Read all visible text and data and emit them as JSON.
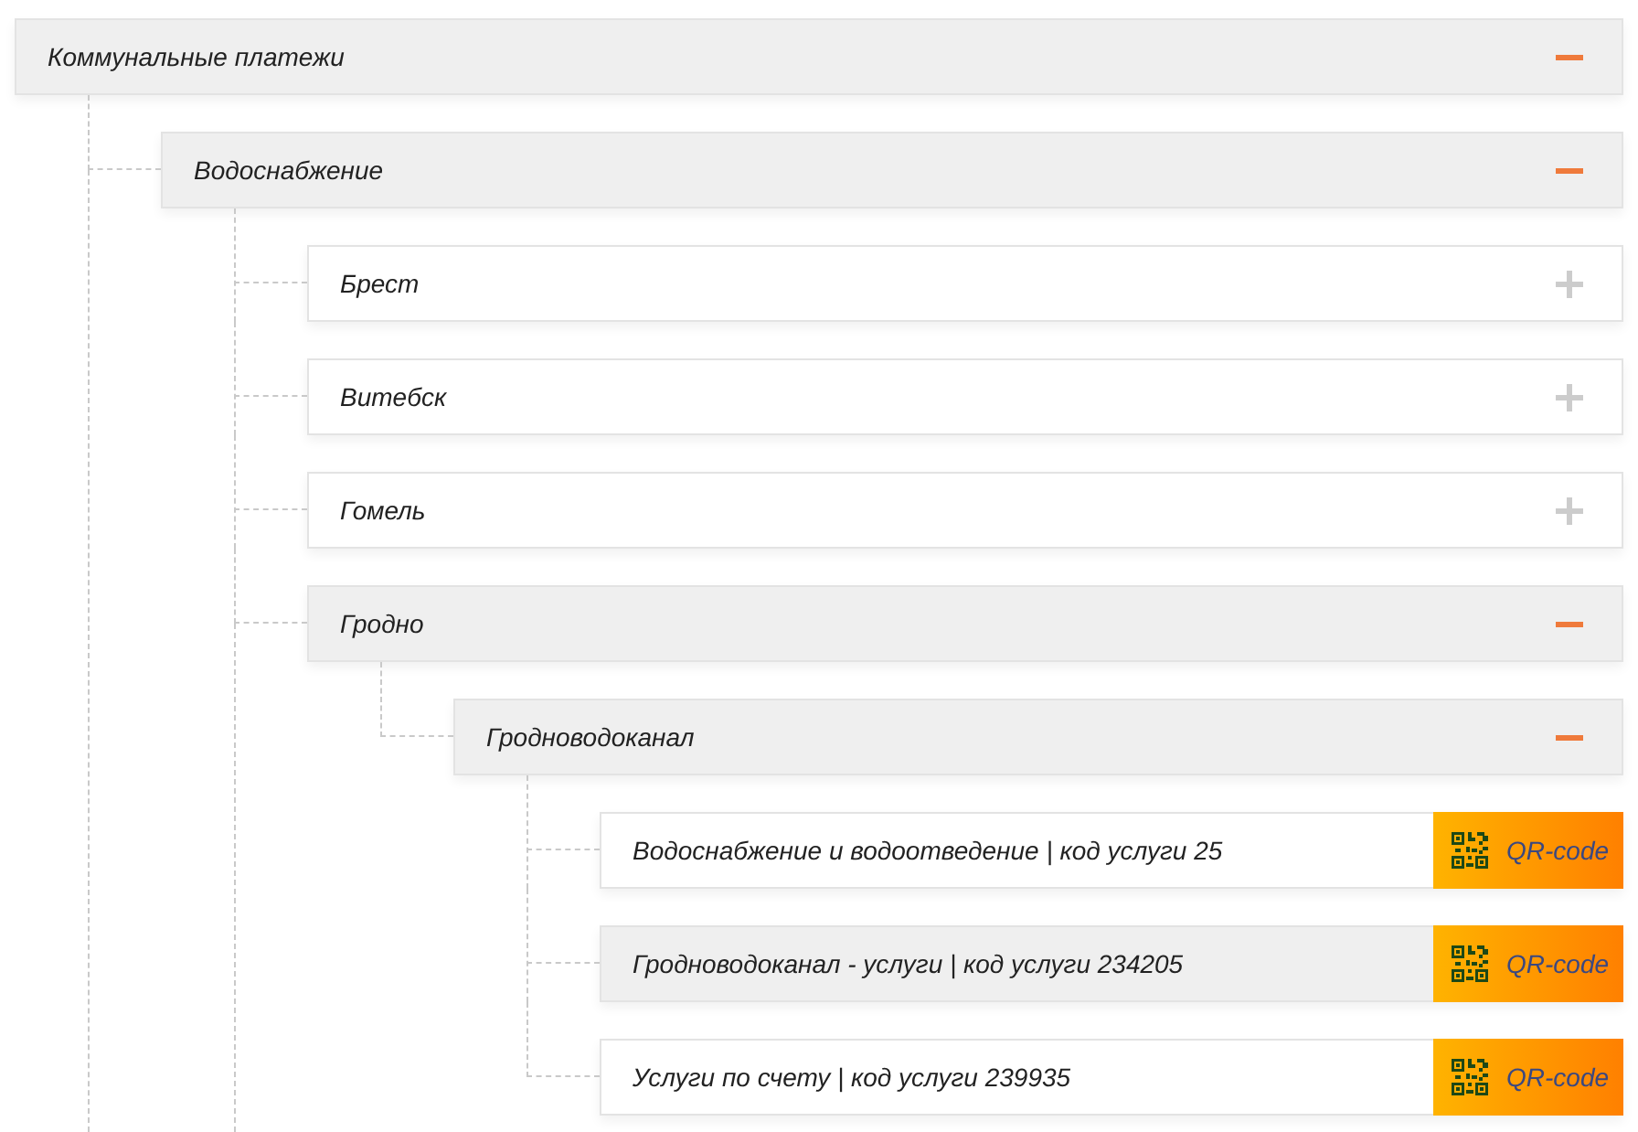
{
  "tree": [
    {
      "label": "Коммунальные платежи",
      "kind": "group",
      "expanded": true,
      "continues": true,
      "children": [
        {
          "label": "Водоснабжение",
          "kind": "group",
          "expanded": true,
          "continues": true,
          "children": [
            {
              "label": "Брест",
              "kind": "group",
              "expanded": false
            },
            {
              "label": "Витебск",
              "kind": "group",
              "expanded": false
            },
            {
              "label": "Гомель",
              "kind": "group",
              "expanded": false
            },
            {
              "label": "Гродно",
              "kind": "group",
              "expanded": true,
              "children": [
                {
                  "label": "Гродноводоканал",
                  "kind": "group",
                  "expanded": true,
                  "children": [
                    {
                      "label": "Водоснабжение и водоотведение | код услуги 25",
                      "kind": "service",
                      "highlighted": false,
                      "button": "QR-code"
                    },
                    {
                      "label": "Гродноводоканал - услуги | код услуги 234205",
                      "kind": "service",
                      "highlighted": true,
                      "button": "QR-code"
                    },
                    {
                      "label": "Услуги по счету | код услуги 239935",
                      "kind": "service",
                      "highlighted": false,
                      "button": "QR-code"
                    }
                  ]
                }
              ]
            }
          ]
        }
      ]
    }
  ]
}
